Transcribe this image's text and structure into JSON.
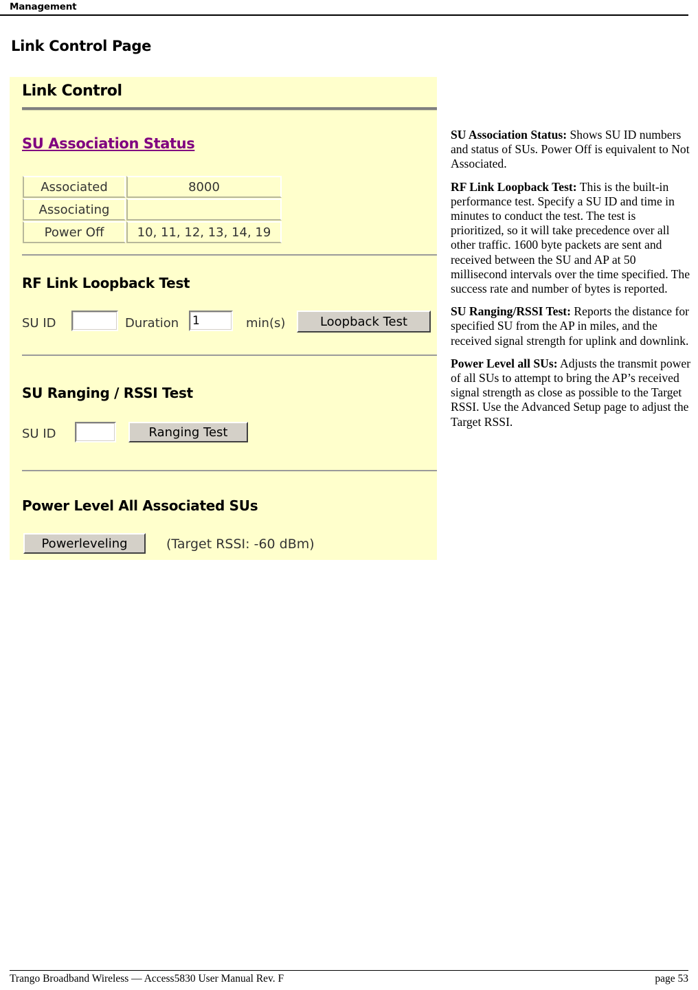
{
  "header": {
    "running_head": "Management"
  },
  "page_title": "Link Control Page",
  "screenshot": {
    "title": "Link Control",
    "association": {
      "heading": "SU Association Status",
      "rows": [
        {
          "label": "Associated",
          "value": "8000"
        },
        {
          "label": "Associating",
          "value": ""
        },
        {
          "label": "Power Off",
          "value": "10, 11, 12, 13, 14, 19"
        }
      ]
    },
    "loopback": {
      "heading": "RF Link Loopback Test",
      "su_id_label": "SU ID",
      "su_id_value": "",
      "duration_label": "Duration",
      "duration_value": "1",
      "units_label": "min(s)",
      "button_label": "Loopback Test"
    },
    "ranging": {
      "heading": "SU Ranging / RSSI Test",
      "su_id_label": "SU ID",
      "su_id_value": "",
      "button_label": "Ranging Test"
    },
    "powerlevel": {
      "heading": "Power Level All Associated SUs",
      "button_label": "Powerleveling",
      "target_note": "(Target RSSI: -60 dBm)"
    },
    "colors": {
      "panel_background": "#ffffcc",
      "link_heading": "#800080",
      "button_face": "#d4d0c8",
      "divider": "#808080"
    }
  },
  "descriptions": [
    {
      "term": "SU Association Status:",
      "text": "  Shows SU ID numbers and status of SUs.  Power Off is equivalent to Not Associated."
    },
    {
      "term": "RF Link Loopback Test:",
      "text": "  This is the built-in performance test.  Specify a SU ID and time in minutes to conduct the test.  The test is prioritized, so it will take precedence over all other traffic.  1600 byte packets are sent and received between the SU and AP at 50 millisecond intervals over the time specified.  The success rate and number of bytes is reported."
    },
    {
      "term": "SU Ranging/RSSI Test:",
      "text": "  Reports the distance for specified SU from the AP in miles, and the received signal strength for uplink and downlink."
    },
    {
      "term": "Power Level all SUs:",
      "text": "  Adjusts the transmit power of all SUs to attempt to bring the AP’s received signal strength as close as possible to the Target RSSI.  Use the Advanced Setup page to adjust the Target RSSI."
    }
  ],
  "footer": {
    "left": "Trango Broadband Wireless — Access5830 User Manual  Rev. F",
    "right": "page 53"
  }
}
